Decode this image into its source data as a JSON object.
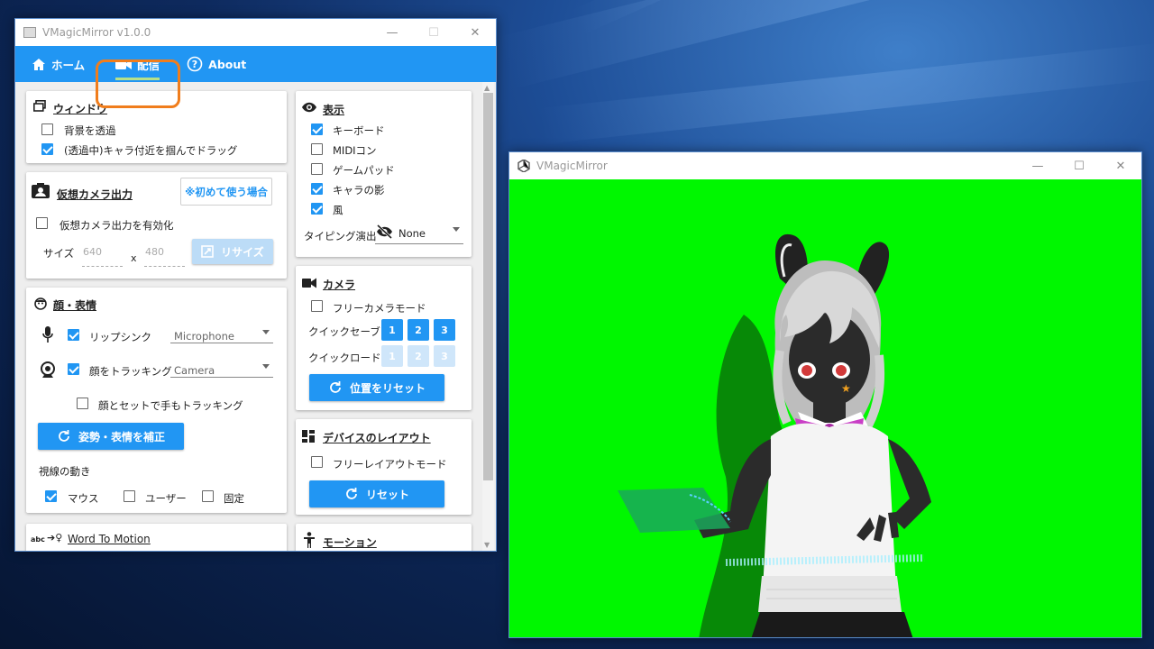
{
  "control_window": {
    "title": "VMagicMirror v1.0.0",
    "controls": {
      "minimize": "—",
      "maximize": "☐",
      "close": "✕"
    },
    "tabs": [
      {
        "label": "ホーム",
        "icon": "home-icon"
      },
      {
        "label": "配信",
        "icon": "video-camera-icon"
      },
      {
        "label": "About",
        "icon": "help-circle-icon"
      }
    ],
    "window_card": {
      "title": "ウィンドウ",
      "transparent_bg": {
        "label": "背景を透過",
        "checked": false
      },
      "drag_character": {
        "label": "(透過中)キャラ付近を掴んでドラッグ",
        "checked": true
      }
    },
    "virtual_camera_card": {
      "title": "仮想カメラ出力",
      "first_use_button": "※初めて使う場合",
      "enable": {
        "label": "仮想カメラ出力を有効化",
        "checked": false
      },
      "size_label": "サイズ",
      "width_placeholder": "640",
      "x_label": "x",
      "height_placeholder": "480",
      "resize_button": "リサイズ"
    },
    "face_card": {
      "title": "顔・表情",
      "lipsync": {
        "label": "リップシンク",
        "checked": true,
        "device": "Microphone"
      },
      "face_tracking": {
        "label": "顔をトラッキング",
        "checked": true,
        "device": "Camera"
      },
      "hand_tracking": {
        "label": "顔とセットで手もトラッキング",
        "checked": false
      },
      "calibrate_button": "姿勢・表情を補正",
      "gaze_label": "視線の動き",
      "gaze_mouse": {
        "label": "マウス",
        "checked": true
      },
      "gaze_user": {
        "label": "ユーザー",
        "checked": false
      },
      "gaze_fixed": {
        "label": "固定",
        "checked": false
      }
    },
    "word_to_motion": {
      "prefix": "abc",
      "title": "Word To Motion"
    },
    "display_card": {
      "title": "表示",
      "keyboard": {
        "label": "キーボード",
        "checked": true
      },
      "midi": {
        "label": "MIDIコン",
        "checked": false
      },
      "gamepad": {
        "label": "ゲームパッド",
        "checked": false
      },
      "shadow": {
        "label": "キャラの影",
        "checked": true
      },
      "wind": {
        "label": "風",
        "checked": true
      },
      "typing_effect_label": "タイピング演出",
      "typing_effect_value": "None"
    },
    "camera_card": {
      "title": "カメラ",
      "free_camera": {
        "label": "フリーカメラモード",
        "checked": false
      },
      "quick_save_label": "クイックセーブ",
      "quick_load_label": "クイックロード",
      "slots": [
        "1",
        "2",
        "3"
      ],
      "reset_position_button": "位置をリセット"
    },
    "layout_card": {
      "title": "デバイスのレイアウト",
      "free_layout": {
        "label": "フリーレイアウトモード",
        "checked": false
      },
      "reset_button": "リセット"
    },
    "motion_card": {
      "title": "モーション"
    }
  },
  "preview_window": {
    "title": "VMagicMirror",
    "controls": {
      "minimize": "—",
      "maximize": "☐",
      "close": "✕"
    },
    "background_color": "#00f700",
    "character_hair_color": "#d8d8d8",
    "character_skin_color": "#2b2b2b",
    "ribbon_color": "#c93fc6"
  },
  "colors": {
    "accent": "#2196f3",
    "highlight": "#f07d1c",
    "tab_underline": "#b5e08a"
  }
}
